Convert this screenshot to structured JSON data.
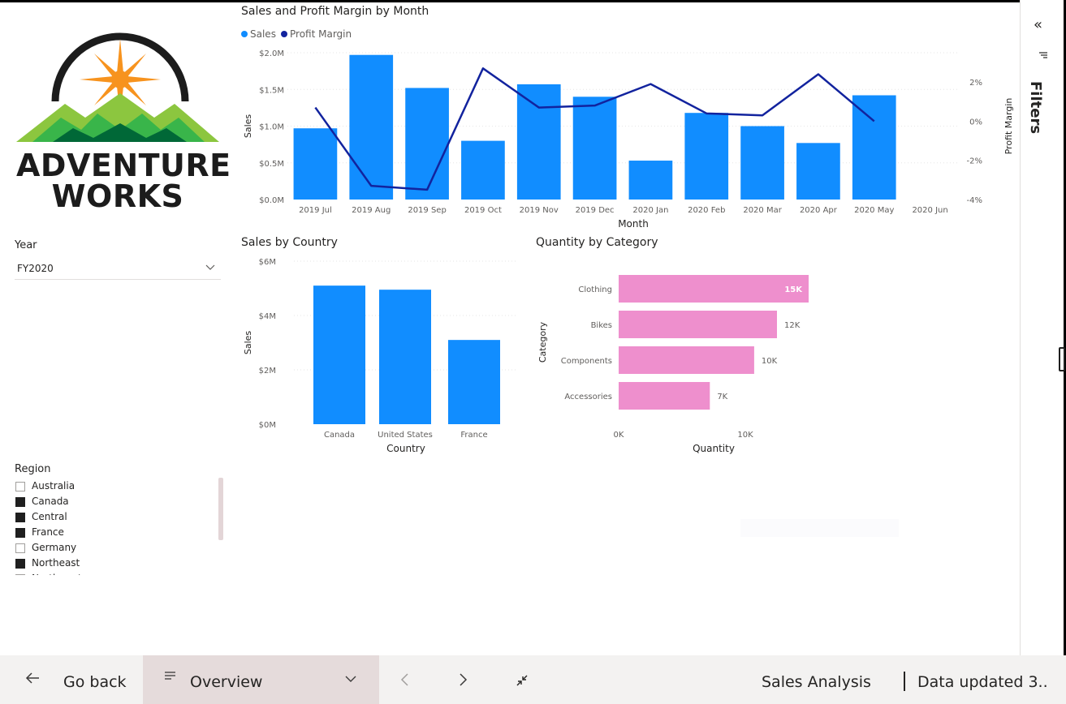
{
  "logo": {
    "line1": "ADVENTURE",
    "line2": "WORKS"
  },
  "year_slicer": {
    "title": "Year",
    "selected": "FY2020"
  },
  "region_slicer": {
    "title": "Region",
    "items": [
      {
        "label": "Australia",
        "checked": false
      },
      {
        "label": "Canada",
        "checked": true
      },
      {
        "label": "Central",
        "checked": true
      },
      {
        "label": "France",
        "checked": true
      },
      {
        "label": "Germany",
        "checked": false
      },
      {
        "label": "Northeast",
        "checked": true
      },
      {
        "label": "Northwest",
        "checked": false
      }
    ]
  },
  "filters_pane": {
    "label": "Filters"
  },
  "bottom_bar": {
    "go_back": "Go back",
    "page": "Overview",
    "report_name": "Sales Analysis",
    "data_updated": "Data updated 3..."
  },
  "colors": {
    "sales": "#118dff",
    "margin": "#12239e",
    "quantity": "#ee8fcd"
  },
  "chart_data": [
    {
      "type": "bar+line",
      "title": "Sales and Profit Margin by Month",
      "legend": [
        "Sales",
        "Profit Margin"
      ],
      "legend_position": "top-left",
      "xlabel": "Month",
      "ylabel": "Sales",
      "y2label": "Profit Margin",
      "categories": [
        "2019 Jul",
        "2019 Aug",
        "2019 Sep",
        "2019 Oct",
        "2019 Nov",
        "2019 Dec",
        "2020 Jan",
        "2020 Feb",
        "2020 Mar",
        "2020 Apr",
        "2020 May",
        "2020 Jun"
      ],
      "yticks": [
        "$0.0M",
        "$0.5M",
        "$1.0M",
        "$1.5M",
        "$2.0M"
      ],
      "y2ticks": [
        "-4%",
        "-2%",
        "0%",
        "2%"
      ],
      "ylim": [
        0,
        2.0
      ],
      "y2lim": [
        -4,
        3.5
      ],
      "series": [
        {
          "name": "Sales",
          "values": [
            0.97,
            1.97,
            1.52,
            0.8,
            1.57,
            1.4,
            0.53,
            1.18,
            1.0,
            0.77,
            1.42,
            null
          ]
        },
        {
          "name": "Profit Margin",
          "values": [
            0.7,
            -3.3,
            -3.5,
            2.7,
            0.7,
            0.8,
            1.9,
            0.4,
            0.3,
            2.4,
            0.0,
            null
          ]
        }
      ],
      "grid": true
    },
    {
      "type": "bar",
      "title": "Sales by Country",
      "xlabel": "Country",
      "ylabel": "Sales",
      "categories": [
        "Canada",
        "United States",
        "France"
      ],
      "values": [
        5.1,
        4.95,
        3.1
      ],
      "yticks": [
        "$0M",
        "$2M",
        "$4M",
        "$6M"
      ],
      "ylim": [
        0,
        6
      ],
      "grid": true
    },
    {
      "type": "bar",
      "orientation": "horizontal",
      "title": "Quantity by Category",
      "xlabel": "Quantity",
      "ylabel": "Category",
      "categories": [
        "Clothing",
        "Bikes",
        "Components",
        "Accessories"
      ],
      "values": [
        15000,
        12500,
        10700,
        7200
      ],
      "data_labels": [
        "15K",
        "12K",
        "10K",
        "7K"
      ],
      "xticks": [
        "0K",
        "10K"
      ],
      "xlim": [
        0,
        20000
      ]
    }
  ]
}
